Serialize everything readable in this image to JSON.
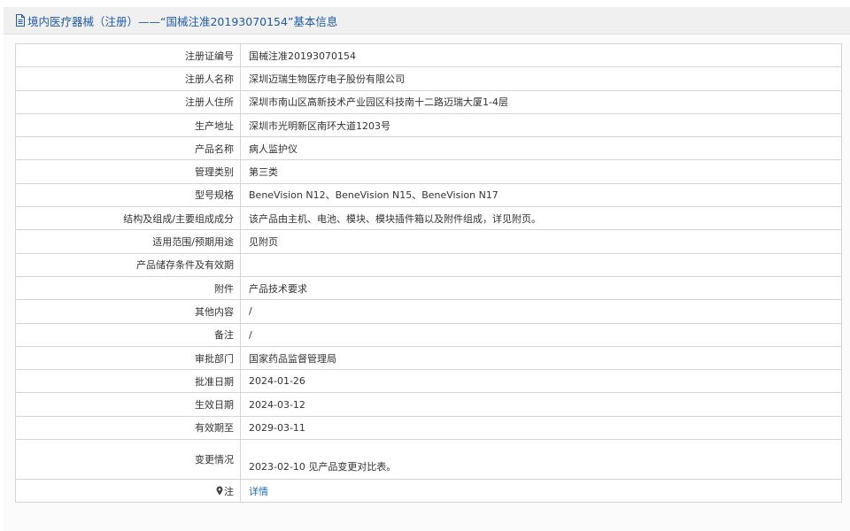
{
  "header": {
    "title": "境内医疗器械（注册）——“国械注准20193070154”基本信息",
    "icon": "document-icon"
  },
  "colors": {
    "title": "#1f5aa6",
    "link": "#1f6fb8",
    "header_bg": "#f0f0f0",
    "border": "#d5d5d5"
  },
  "rows": [
    {
      "label": "注册证编号",
      "value": "国械注准20193070154"
    },
    {
      "label": "注册人名称",
      "value": "深圳迈瑞生物医疗电子股份有限公司"
    },
    {
      "label": "注册人住所",
      "value": "深圳市南山区高新技术产业园区科技南十二路迈瑞大厦1-4层"
    },
    {
      "label": "生产地址",
      "value": "深圳市光明新区南环大道1203号"
    },
    {
      "label": "产品名称",
      "value": "病人监护仪"
    },
    {
      "label": "管理类别",
      "value": "第三类"
    },
    {
      "label": "型号规格",
      "value": "BeneVision N12、BeneVision N15、BeneVision N17"
    },
    {
      "label": "结构及组成/主要组成成分",
      "value": "该产品由主机、电池、模块、模块插件箱以及附件组成，详见附页。"
    },
    {
      "label": "适用范围/预期用途",
      "value": "见附页"
    },
    {
      "label": "产品储存条件及有效期",
      "value": ""
    },
    {
      "label": "附件",
      "value": "产品技术要求"
    },
    {
      "label": "其他内容",
      "value": "/"
    },
    {
      "label": "备注",
      "value": "/"
    },
    {
      "label": "审批部门",
      "value": "国家药品监督管理局"
    },
    {
      "label": "批准日期",
      "value": "2024-01-26"
    },
    {
      "label": "生效日期",
      "value": "2024-03-12"
    },
    {
      "label": "有效期至",
      "value": "2029-03-11"
    },
    {
      "label": "变更情况",
      "value": "2023-02-10 见产品变更对比表。"
    }
  ],
  "note_row": {
    "label": "注",
    "icon": "pin-icon",
    "link_text": "详情"
  }
}
